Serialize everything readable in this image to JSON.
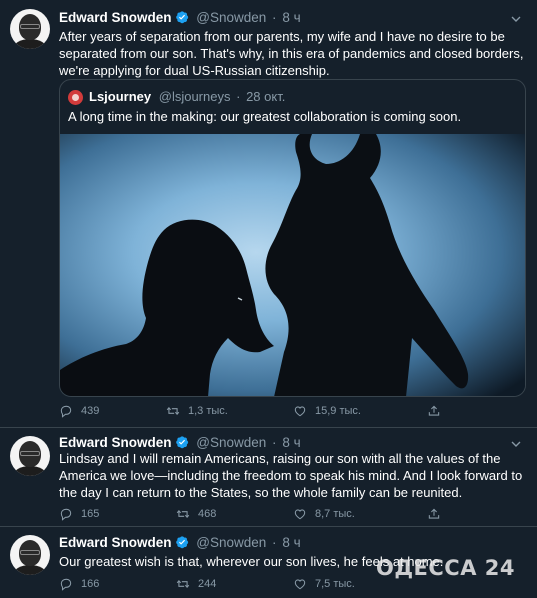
{
  "tweets": [
    {
      "author": "Edward Snowden",
      "handle": "@Snowden",
      "sep": "·",
      "time": "8 ч",
      "text": "After years of separation from our parents, my wife and I have no desire to be separated from our son. That's why, in this era of pandemics and closed borders, we're applying for dual US-Russian citizenship.",
      "quote": {
        "author": "Lsjourney",
        "handle": "@lsjourneys",
        "sep": "·",
        "time": "28 окт.",
        "text": "A long time in the making: our greatest collaboration is coming soon."
      },
      "replies": "439",
      "retweets": "1,3 тыс.",
      "likes": "15,9 тыс."
    },
    {
      "author": "Edward Snowden",
      "handle": "@Snowden",
      "sep": "·",
      "time": "8 ч",
      "text": "Lindsay and I will remain Americans, raising our son with all the values of the America we love—including the freedom to speak his mind. And I look forward to the day I can return to the States, so the whole family can be reunited.",
      "replies": "165",
      "retweets": "468",
      "likes": "8,7 тыс."
    },
    {
      "author": "Edward Snowden",
      "handle": "@Snowden",
      "sep": "·",
      "time": "8 ч",
      "text": "Our greatest wish is that, wherever our son lives, he feels at home.",
      "replies": "166",
      "retweets": "244",
      "likes": "7,5 тыс."
    }
  ],
  "watermark": "ОДЕССА 24",
  "colors": {
    "background": "#15202b",
    "border": "#38444d",
    "muted": "#8899a6",
    "verified": "#1da1f2"
  },
  "icons": [
    "verified-badge-icon",
    "more-chevron-icon",
    "reply-icon",
    "retweet-icon",
    "like-icon",
    "share-icon"
  ]
}
